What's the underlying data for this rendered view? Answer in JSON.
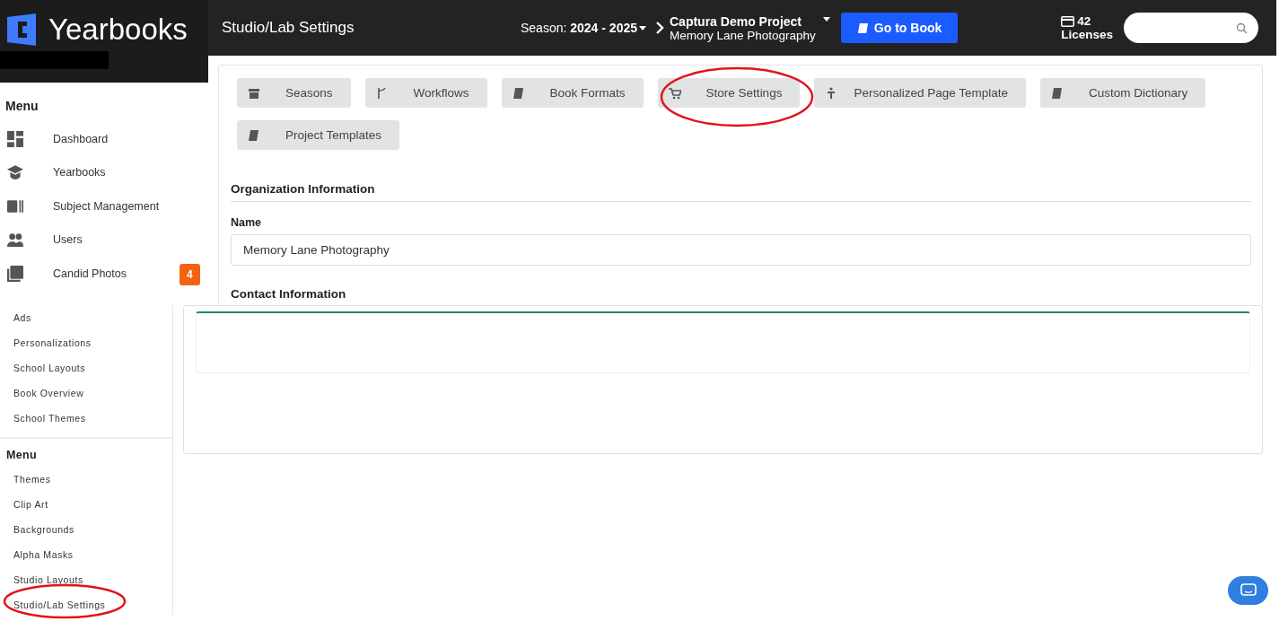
{
  "app": {
    "name": "Yearbooks"
  },
  "header": {
    "title": "Studio/Lab Settings",
    "season": "Season: **2024 - 2025**",
    "project": {
      "name": "Captura Demo Project",
      "studio": "Memory Lane Photography"
    },
    "go_button": "Go to Book",
    "licenses": {
      "count": "42",
      "label": "Licenses"
    }
  },
  "sidebar": {
    "heading": "Menu",
    "items": [
      {
        "label": "Dashboard"
      },
      {
        "label": "Yearbooks"
      },
      {
        "label": "Subject Management"
      },
      {
        "label": "Users"
      },
      {
        "label": "Candid Photos",
        "badge": "4"
      }
    ]
  },
  "settings_tabs": [
    {
      "label": "Seasons",
      "annotated": false
    },
    {
      "label": "Workflows",
      "annotated": false
    },
    {
      "label": "Book Formats",
      "annotated": false
    },
    {
      "label": "Store Settings",
      "annotated": true
    },
    {
      "label": "Personalized Page Template",
      "annotated": false
    },
    {
      "label": "Custom Dictionary",
      "annotated": false
    },
    {
      "label": "Project Templates",
      "annotated": false
    }
  ],
  "organization": {
    "heading": "Organization Information",
    "name_label": "Name",
    "name_value": "Memory Lane Photography",
    "contact_heading": "Contact Information"
  },
  "sidebar_lower": {
    "items": [
      {
        "label": "Ads"
      },
      {
        "label": "Personalizations"
      },
      {
        "label": "School Layouts"
      },
      {
        "label": "Book Overview"
      },
      {
        "label": "School Themes"
      }
    ],
    "section": {
      "heading": "Menu",
      "items": [
        {
          "label": "Themes",
          "annotated": false
        },
        {
          "label": "Clip Art",
          "annotated": false
        },
        {
          "label": "Backgrounds",
          "annotated": false
        },
        {
          "label": "Alpha Masks",
          "annotated": false
        },
        {
          "label": "Studio Layouts",
          "annotated": false
        },
        {
          "label": "Studio/Lab Settings",
          "annotated": true
        }
      ]
    }
  }
}
